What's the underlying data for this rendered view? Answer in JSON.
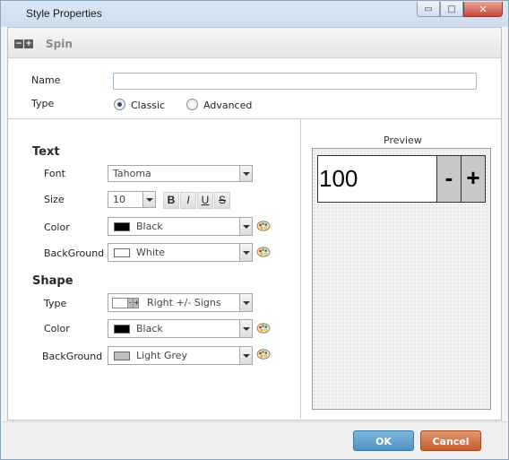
{
  "window": {
    "title": "Style Properties",
    "controls": {
      "minimize": "▭",
      "maximize": "□",
      "close": "✕"
    }
  },
  "section": {
    "title": "Spin",
    "collapse_glyph": "−",
    "expand_glyph": "+"
  },
  "general": {
    "name_label": "Name",
    "name_value": "",
    "type_label": "Type",
    "type_options": [
      {
        "label": "Classic",
        "checked": true
      },
      {
        "label": "Advanced",
        "checked": false
      }
    ]
  },
  "text_group": {
    "title": "Text",
    "font_label": "Font",
    "font_value": "Tahoma",
    "size_label": "Size",
    "size_value": "10",
    "format_buttons": {
      "bold": "B",
      "italic": "I",
      "underline": "U",
      "strike": "S"
    },
    "color_label": "Color",
    "color_value": "Black",
    "color_swatch": "#000000",
    "background_label": "BackGround",
    "background_value": "White",
    "background_swatch": "#ffffff"
  },
  "shape_group": {
    "title": "Shape",
    "type_label": "Type",
    "type_value": "Right +/- Signs",
    "type_icon_minus": "-",
    "type_icon_plus": "+",
    "color_label": "Color",
    "color_value": "Black",
    "color_swatch": "#000000",
    "background_label": "BackGround",
    "background_value": "Light Grey",
    "background_swatch": "#c0c0c0"
  },
  "preview": {
    "label": "Preview",
    "spin_value": "100",
    "minus": "-",
    "plus": "+"
  },
  "footer": {
    "ok_label": "OK",
    "cancel_label": "Cancel"
  },
  "colors": {
    "ok": "#5a9fcc",
    "cancel": "#d06e3e",
    "accent_title": "#dbe7f5"
  }
}
